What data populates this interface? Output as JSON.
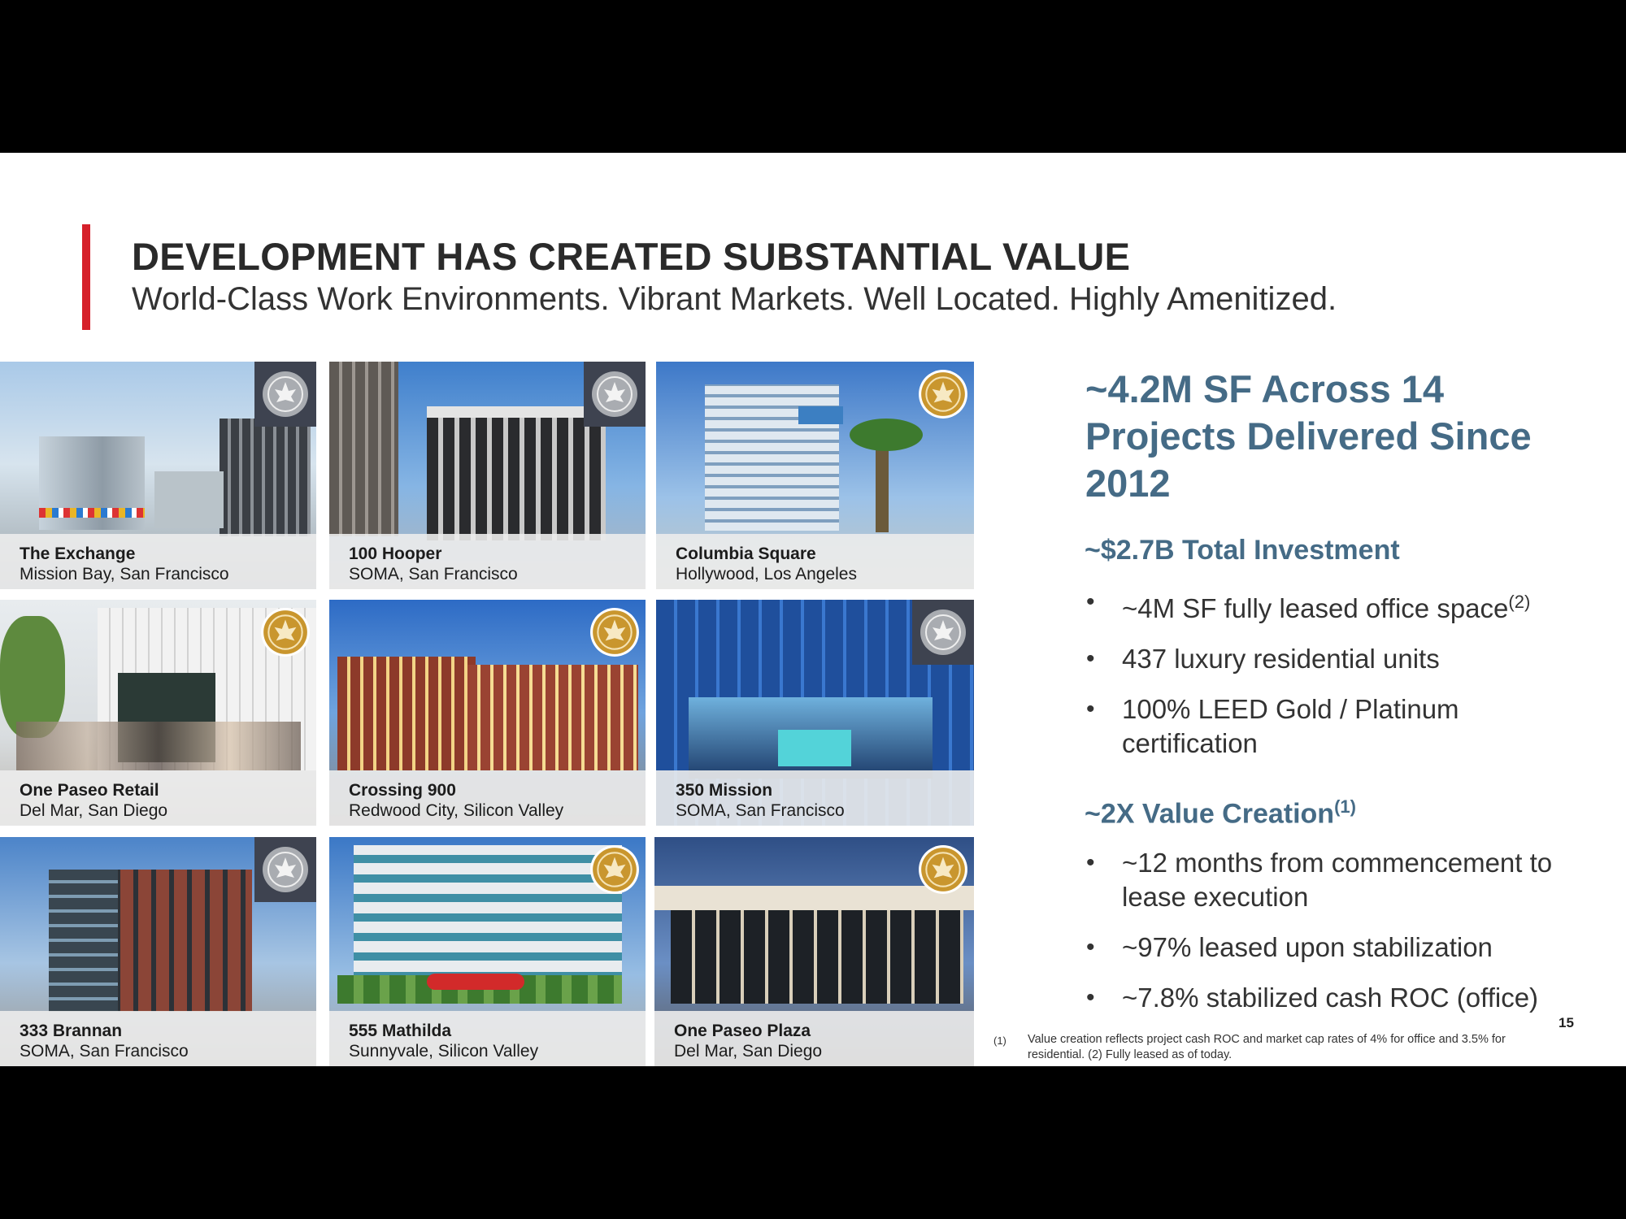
{
  "title": "DEVELOPMENT HAS CREATED SUBSTANTIAL VALUE",
  "subtitle": "World-Class Work Environments. Vibrant Markets. Well Located. Highly Amenitized.",
  "properties": [
    {
      "name": "The Exchange",
      "location": "Mission Bay, San Francisco",
      "certification": "platinum"
    },
    {
      "name": "100 Hooper",
      "location": "SOMA, San Francisco",
      "certification": "platinum"
    },
    {
      "name": "Columbia Square",
      "location": "Hollywood, Los Angeles",
      "certification": "gold"
    },
    {
      "name": "One Paseo Retail",
      "location": "Del Mar, San Diego",
      "certification": "gold"
    },
    {
      "name": "Crossing 900",
      "location": "Redwood City, Silicon Valley",
      "certification": "gold"
    },
    {
      "name": "350 Mission",
      "location": "SOMA, San Francisco",
      "certification": "platinum"
    },
    {
      "name": "333 Brannan",
      "location": "SOMA, San Francisco",
      "certification": "platinum"
    },
    {
      "name": "555 Mathilda",
      "location": "Sunnyvale, Silicon Valley",
      "certification": "gold"
    },
    {
      "name": "One Paseo Plaza",
      "location": "Del Mar, San Diego",
      "certification": "gold"
    }
  ],
  "headline": "~4.2M SF Across 14 Projects Delivered Since 2012",
  "investment": {
    "title": "~$2.7B Total Investment",
    "bullets": [
      {
        "text": "~4M SF fully leased office space",
        "sup": "(2)"
      },
      {
        "text": "437 luxury residential units",
        "sup": ""
      },
      {
        "text": "100% LEED Gold / Platinum certification",
        "sup": ""
      }
    ]
  },
  "value_creation": {
    "title": "~2X Value Creation",
    "sup": "(1)",
    "bullets": [
      {
        "text": "~12 months from commencement to lease execution"
      },
      {
        "text": "~97% leased upon stabilization"
      },
      {
        "text": "~7.8% stabilized cash ROC (office)"
      }
    ]
  },
  "page_number": "15",
  "footnote_marker": "(1)",
  "footnote": "Value creation reflects project cash ROC and market cap rates of 4% for office and 3.5% for residential.  (2) Fully leased as of today.",
  "colors": {
    "accent_red": "#d6202a",
    "headline_blue": "#456b86",
    "leed_gold": "#c9962e",
    "leed_platinum": "#a9acb1",
    "leed_backing": "#3e4350"
  }
}
